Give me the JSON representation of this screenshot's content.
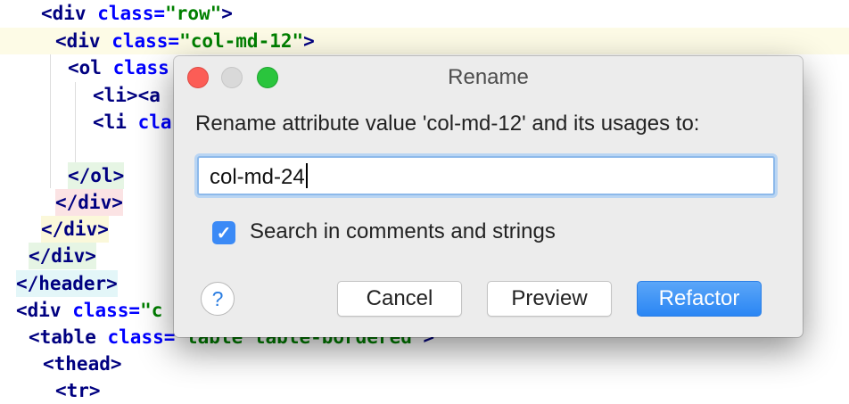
{
  "editor": {
    "lines": [
      {
        "indent": "  ",
        "html": "<div class=\"row\">"
      },
      {
        "indent": "   ",
        "html": "<div class=\"col-md-12\">"
      },
      {
        "indent": "    ",
        "html": "<ol class"
      },
      {
        "indent": "      ",
        "html": "<li><a"
      },
      {
        "indent": "      ",
        "html": "<li cla"
      },
      {
        "indent": "",
        "html": ""
      },
      {
        "indent": "    ",
        "html": "</ol>"
      },
      {
        "indent": "   ",
        "html": "</div>"
      },
      {
        "indent": "  ",
        "html": "</div>"
      },
      {
        "indent": " ",
        "html": "</div>"
      },
      {
        "indent": "",
        "html": "</header>"
      },
      {
        "indent": "",
        "html": "<div class=\"c"
      },
      {
        "indent": " ",
        "html": "<table class=\"table table-bordered\">"
      },
      {
        "indent": "  ",
        "html": "<thead>"
      },
      {
        "indent": "   ",
        "html": "<tr>"
      }
    ]
  },
  "dialog": {
    "title": "Rename",
    "prompt": "Rename attribute value 'col-md-12' and its usages to:",
    "input_value": "col-md-24",
    "checkbox_label": "Search in comments and strings",
    "checkbox_checked": true,
    "help_label": "?",
    "buttons": {
      "cancel": "Cancel",
      "preview": "Preview",
      "refactor": "Refactor"
    },
    "accent_color": "#2a86f4"
  }
}
